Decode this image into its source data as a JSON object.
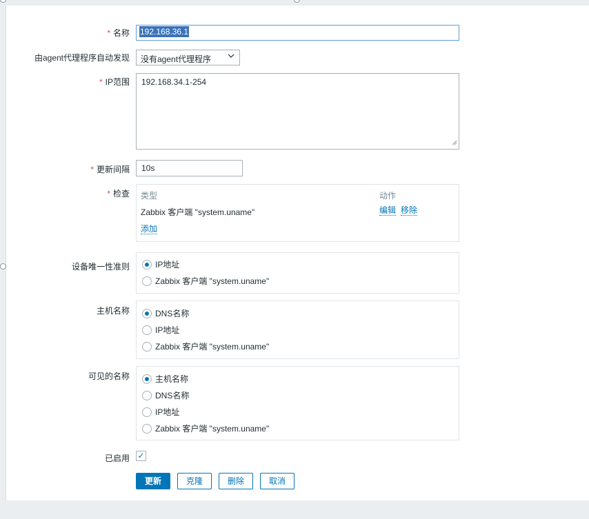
{
  "form": {
    "name": {
      "label": "名称",
      "value": "192.168.36.1"
    },
    "proxy": {
      "label": "由agent代理程序自动发现",
      "selected": "没有agent代理程序"
    },
    "ip_range": {
      "label": "IP范围",
      "value": "192.168.34.1-254"
    },
    "update_interval": {
      "label": "更新间隔",
      "value": "10s"
    },
    "checks": {
      "label": "检查",
      "col_type": "类型",
      "col_action": "动作",
      "rows": [
        {
          "type": "Zabbix 客户端 \"system.uname\"",
          "edit": "编辑",
          "remove": "移除"
        }
      ],
      "add_link": "添加"
    },
    "uniqueness": {
      "label": "设备唯一性准则",
      "options": [
        "IP地址",
        "Zabbix 客户端 \"system.uname\""
      ],
      "selected_index": 0
    },
    "host_name": {
      "label": "主机名称",
      "options": [
        "DNS名称",
        "IP地址",
        "Zabbix 客户端 \"system.uname\""
      ],
      "selected_index": 0
    },
    "visible_name": {
      "label": "可见的名称",
      "options": [
        "主机名称",
        "DNS名称",
        "IP地址",
        "Zabbix 客户端 \"system.uname\""
      ],
      "selected_index": 0
    },
    "enabled": {
      "label": "已启用",
      "checked": true,
      "check_glyph": "✓"
    },
    "required_mark": "*"
  },
  "buttons": {
    "update": "更新",
    "clone": "克隆",
    "delete": "删除",
    "cancel": "取消"
  },
  "colors": {
    "accent": "#0275b8",
    "required": "#d64e4e",
    "selection": "#3b73b9"
  }
}
